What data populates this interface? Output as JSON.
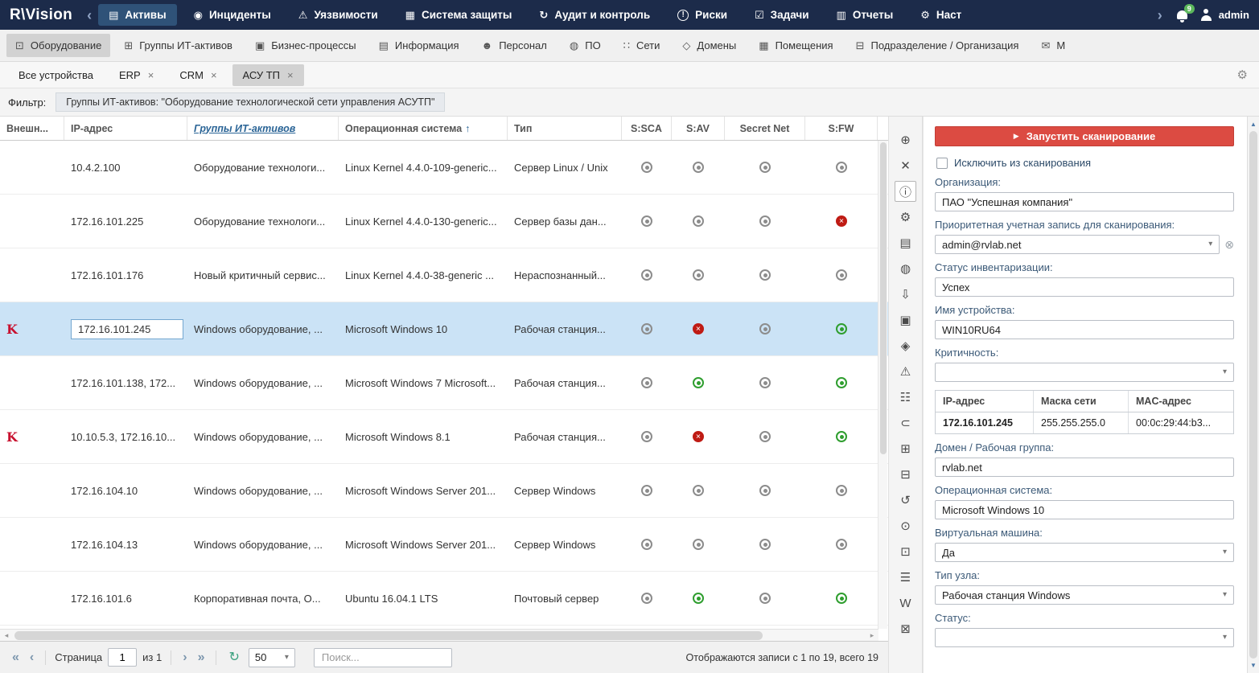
{
  "colors": {
    "topnav_bg": "#1c2b4a",
    "nav_active_bg": "#2f5278",
    "scan_button_red": "#dc4b42",
    "status_green": "#2f9e2f",
    "status_red": "#bf1b14",
    "status_gray": "#8c8c8c",
    "selected_row_blue": "#cbe3f6",
    "link_blue": "#2a6496",
    "badge_green": "#5cb85c"
  },
  "glyphs": {
    "caret": "▾",
    "sort_asc": "↑",
    "close_tab": "×",
    "clear": "⊗",
    "play": "▶",
    "first": "«",
    "prev": "‹",
    "next": "›",
    "last": "»",
    "refresh": "↻",
    "scroll_up": "▲",
    "scroll_down": "▼",
    "h_left": "◂",
    "h_right": "▸",
    "settings": "⚙"
  },
  "topnav": {
    "logo": "R\\Vision",
    "collapse_icon": "‹",
    "more_icon": "›",
    "notification_count": "9",
    "user": "admin",
    "items": [
      {
        "name": "nav-item-assets",
        "label": "Активы",
        "icon": "assets-icon",
        "glyph": "▤",
        "active": true
      },
      {
        "name": "nav-item-incidents",
        "label": "Инциденты",
        "icon": "incidents-icon",
        "glyph": "◉"
      },
      {
        "name": "nav-item-vulnerabilities",
        "label": "Уязвимости",
        "icon": "vulnerabilities-icon",
        "glyph": "⚠"
      },
      {
        "name": "nav-item-protection-system",
        "label": "Система защиты",
        "icon": "protection-system-icon",
        "glyph": "▦"
      },
      {
        "name": "nav-item-audit",
        "label": "Аудит и контроль",
        "icon": "audit-icon",
        "glyph": "↻"
      },
      {
        "name": "nav-item-risks",
        "label": "Риски",
        "icon": "risks-icon",
        "glyph": "!"
      },
      {
        "name": "nav-item-tasks",
        "label": "Задачи",
        "icon": "tasks-icon",
        "glyph": "☑"
      },
      {
        "name": "nav-item-reports",
        "label": "Отчеты",
        "icon": "reports-icon",
        "glyph": "▥"
      },
      {
        "name": "nav-item-settings",
        "label": "Наст",
        "icon": "settings-icon",
        "glyph": "⚙"
      }
    ]
  },
  "module_tabs": [
    {
      "name": "tab-equipment",
      "label": "Оборудование",
      "icon": "equipment-icon",
      "glyph": "⊡",
      "active": true
    },
    {
      "name": "tab-it-asset-groups",
      "label": "Группы ИТ-активов",
      "icon": "groups-icon",
      "glyph": "⊞"
    },
    {
      "name": "tab-business-processes",
      "label": "Бизнес-процессы",
      "icon": "business-process-icon",
      "glyph": "▣"
    },
    {
      "name": "tab-information",
      "label": "Информация",
      "icon": "information-icon",
      "glyph": "▤"
    },
    {
      "name": "tab-personnel",
      "label": "Персонал",
      "icon": "personnel-icon",
      "glyph": "☻"
    },
    {
      "name": "tab-software",
      "label": "ПО",
      "icon": "software-icon",
      "glyph": "◍"
    },
    {
      "name": "tab-networks",
      "label": "Сети",
      "icon": "networks-icon",
      "glyph": "∷"
    },
    {
      "name": "tab-domains",
      "label": "Домены",
      "icon": "domains-icon",
      "glyph": "◇"
    },
    {
      "name": "tab-rooms",
      "label": "Помещения",
      "icon": "rooms-icon",
      "glyph": "▦"
    },
    {
      "name": "tab-organization",
      "label": "Подразделение / Организация",
      "icon": "organization-icon",
      "glyph": "⊟"
    },
    {
      "name": "tab-more",
      "label": "М",
      "icon": "mail-icon",
      "glyph": "✉"
    }
  ],
  "device_tabs": [
    {
      "name": "device-tab-all",
      "label": "Все устройства",
      "closable": false
    },
    {
      "name": "device-tab-erp",
      "label": "ERP",
      "closable": true
    },
    {
      "name": "device-tab-crm",
      "label": "CRM",
      "closable": true
    },
    {
      "name": "device-tab-asutp",
      "label": "АСУ ТП",
      "closable": true,
      "active": true
    }
  ],
  "filter": {
    "label": "Фильтр:",
    "value": "Группы ИТ-активов: \"Оборудование технологической сети управления АСУТП\""
  },
  "table": {
    "columns": [
      "Внешн...",
      "IP-адрес",
      "Группы ИТ-активов",
      "Операционная система",
      "Тип",
      "S:SCA",
      "S:AV",
      "Secret Net",
      "S:FW"
    ],
    "rows": [
      {
        "ip": "10.4.2.100",
        "group": "Оборудование технологи...",
        "os": "Linux Kernel 4.4.0-109-generic...",
        "type": "Сервер Linux / Unix",
        "s_sca": "gray",
        "s_av": "gray",
        "secret_net": "gray",
        "s_fw": "gray"
      },
      {
        "ip": "172.16.101.225",
        "group": "Оборудование технологи...",
        "os": "Linux Kernel 4.4.0-130-generic...",
        "type": "Сервер базы дан...",
        "s_sca": "gray",
        "s_av": "gray",
        "secret_net": "gray",
        "s_fw": "red"
      },
      {
        "ip": "172.16.101.176",
        "group": "Новый критичный сервис...",
        "os": "Linux Kernel 4.4.0-38-generic ...",
        "type": "Нераспознанный...",
        "s_sca": "gray",
        "s_av": "gray",
        "secret_net": "gray",
        "s_fw": "gray"
      },
      {
        "ip": "172.16.101.245",
        "group": "Windows оборудование, ...",
        "os": "Microsoft Windows 10",
        "type": "Рабочая станция...",
        "s_sca": "gray",
        "s_av": "red",
        "secret_net": "gray",
        "s_fw": "green",
        "selected": true,
        "editing": true,
        "external": true
      },
      {
        "ip": "172.16.101.138, 172...",
        "group": "Windows оборудование, ...",
        "os": "Microsoft Windows 7 Microsoft...",
        "type": "Рабочая станция...",
        "s_sca": "gray",
        "s_av": "green",
        "secret_net": "gray",
        "s_fw": "green"
      },
      {
        "ip": "10.10.5.3, 172.16.10...",
        "group": "Windows оборудование, ...",
        "os": "Microsoft Windows 8.1",
        "type": "Рабочая станция...",
        "s_sca": "gray",
        "s_av": "red",
        "secret_net": "gray",
        "s_fw": "green",
        "external": true
      },
      {
        "ip": "172.16.104.10",
        "group": "Windows оборудование, ...",
        "os": "Microsoft Windows Server 201...",
        "type": "Сервер Windows",
        "s_sca": "gray",
        "s_av": "gray",
        "secret_net": "gray",
        "s_fw": "gray"
      },
      {
        "ip": "172.16.104.13",
        "group": "Windows оборудование, ...",
        "os": "Microsoft Windows Server 201...",
        "type": "Сервер Windows",
        "s_sca": "gray",
        "s_av": "gray",
        "secret_net": "gray",
        "s_fw": "gray"
      },
      {
        "ip": "172.16.101.6",
        "group": "Корпоративная почта, О...",
        "os": "Ubuntu 16.04.1 LTS",
        "type": "Почтовый сервер",
        "s_sca": "gray",
        "s_av": "green",
        "secret_net": "gray",
        "s_fw": "green"
      }
    ]
  },
  "side_toolbar": [
    {
      "name": "zoom-icon",
      "glyph": "⊕"
    },
    {
      "name": "close-icon",
      "glyph": "✕"
    },
    {
      "name": "info-icon",
      "glyph": "ⓘ",
      "active": true
    },
    {
      "name": "gear-icon",
      "glyph": "⚙"
    },
    {
      "name": "details-view-icon",
      "glyph": "▤"
    },
    {
      "name": "globe-icon",
      "glyph": "◍"
    },
    {
      "name": "download-icon",
      "glyph": "⇩"
    },
    {
      "name": "passport-icon",
      "glyph": "▣"
    },
    {
      "name": "shield-icon",
      "glyph": "◈"
    },
    {
      "name": "warning-icon",
      "glyph": "⚠"
    },
    {
      "name": "inventory-list-icon",
      "glyph": "☷"
    },
    {
      "name": "attachment-icon",
      "glyph": "⊂"
    },
    {
      "name": "copy-icon",
      "glyph": "⊞"
    },
    {
      "name": "clipboard-icon",
      "glyph": "⊟"
    },
    {
      "name": "history-icon",
      "glyph": "↺"
    },
    {
      "name": "scan-search-icon",
      "glyph": "⊙"
    },
    {
      "name": "monitor-icon",
      "glyph": "⊡"
    },
    {
      "name": "menu-icon",
      "glyph": "☰"
    },
    {
      "name": "word-export-icon",
      "glyph": "W"
    },
    {
      "name": "export-icon",
      "glyph": "⊠"
    }
  ],
  "panel": {
    "scan_button": "Запустить сканирование",
    "exclude_checkbox": "Исключить из сканирования",
    "org_label": "Организация:",
    "org_value": "ПАО \"Успешная компания\"",
    "account_label": "Приоритетная учетная запись для сканирования:",
    "account_value": "admin@rvlab.net",
    "inventory_status_label": "Статус инвентаризации:",
    "inventory_status_value": "Успех",
    "device_name_label": "Имя устройства:",
    "device_name_value": "WIN10RU64",
    "criticality_label": "Критичность:",
    "criticality_value": "",
    "ip_table": {
      "headers": [
        "IP-адрес",
        "Маска сети",
        "MAC-адрес"
      ],
      "row": [
        "172.16.101.245",
        "255.255.255.0",
        "00:0c:29:44:b3..."
      ]
    },
    "domain_label": "Домен / Рабочая группа:",
    "domain_value": "rvlab.net",
    "os_label": "Операционная система:",
    "os_value": "Microsoft Windows 10",
    "vm_label": "Виртуальная машина:",
    "vm_value": "Да",
    "node_type_label": "Тип узла:",
    "node_type_value": "Рабочая станция Windows",
    "status_label": "Статус:",
    "status_value": ""
  },
  "footer": {
    "page_label": "Страница",
    "page_value": "1",
    "of_label": "из 1",
    "page_size": "50",
    "search_placeholder": "Поиск...",
    "records_info": "Отображаются записи с 1 по 19, всего 19"
  }
}
